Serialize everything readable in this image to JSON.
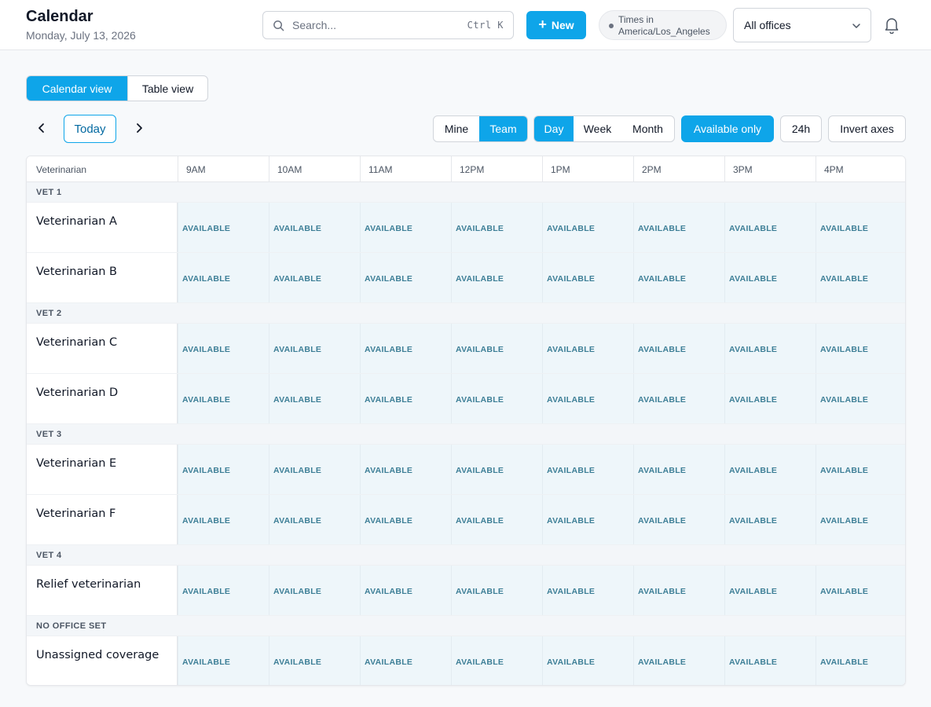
{
  "header": {
    "title": "Calendar",
    "date": "Monday, July 13, 2026",
    "search_placeholder": "Search...",
    "search_shortcut": "Ctrl K",
    "new_label": "New",
    "tz_line1": "Times in",
    "tz_line2": "America/Los_Angeles",
    "office_select": "All offices"
  },
  "view_toggle": {
    "calendar": "Calendar view",
    "table": "Table view",
    "active": "calendar"
  },
  "nav": {
    "today": "Today"
  },
  "scope": {
    "mine": "Mine",
    "team": "Team",
    "active": "team"
  },
  "range": {
    "day": "Day",
    "week": "Week",
    "month": "Month",
    "active": "day"
  },
  "filters": {
    "available_only": "Available only",
    "h24": "24h",
    "invert_axes": "Invert axes"
  },
  "grid": {
    "vet_header": "Veterinarian",
    "hours": [
      "9AM",
      "10AM",
      "11AM",
      "12PM",
      "1PM",
      "2PM",
      "3PM",
      "4PM"
    ],
    "cell_label": "AVAILABLE",
    "groups": [
      {
        "name": "VET 1",
        "rows": [
          "Veterinarian A",
          "Veterinarian B"
        ]
      },
      {
        "name": "VET 2",
        "rows": [
          "Veterinarian C",
          "Veterinarian D"
        ]
      },
      {
        "name": "VET 3",
        "rows": [
          "Veterinarian E",
          "Veterinarian F"
        ]
      },
      {
        "name": "VET 4",
        "rows": [
          "Relief veterinarian"
        ]
      },
      {
        "name": "NO OFFICE SET",
        "rows": [
          "Unassigned coverage"
        ]
      }
    ]
  },
  "colors": {
    "accent": "#0ea5e9",
    "available_bg": "#eef6fa",
    "available_text": "#3e7f97"
  }
}
